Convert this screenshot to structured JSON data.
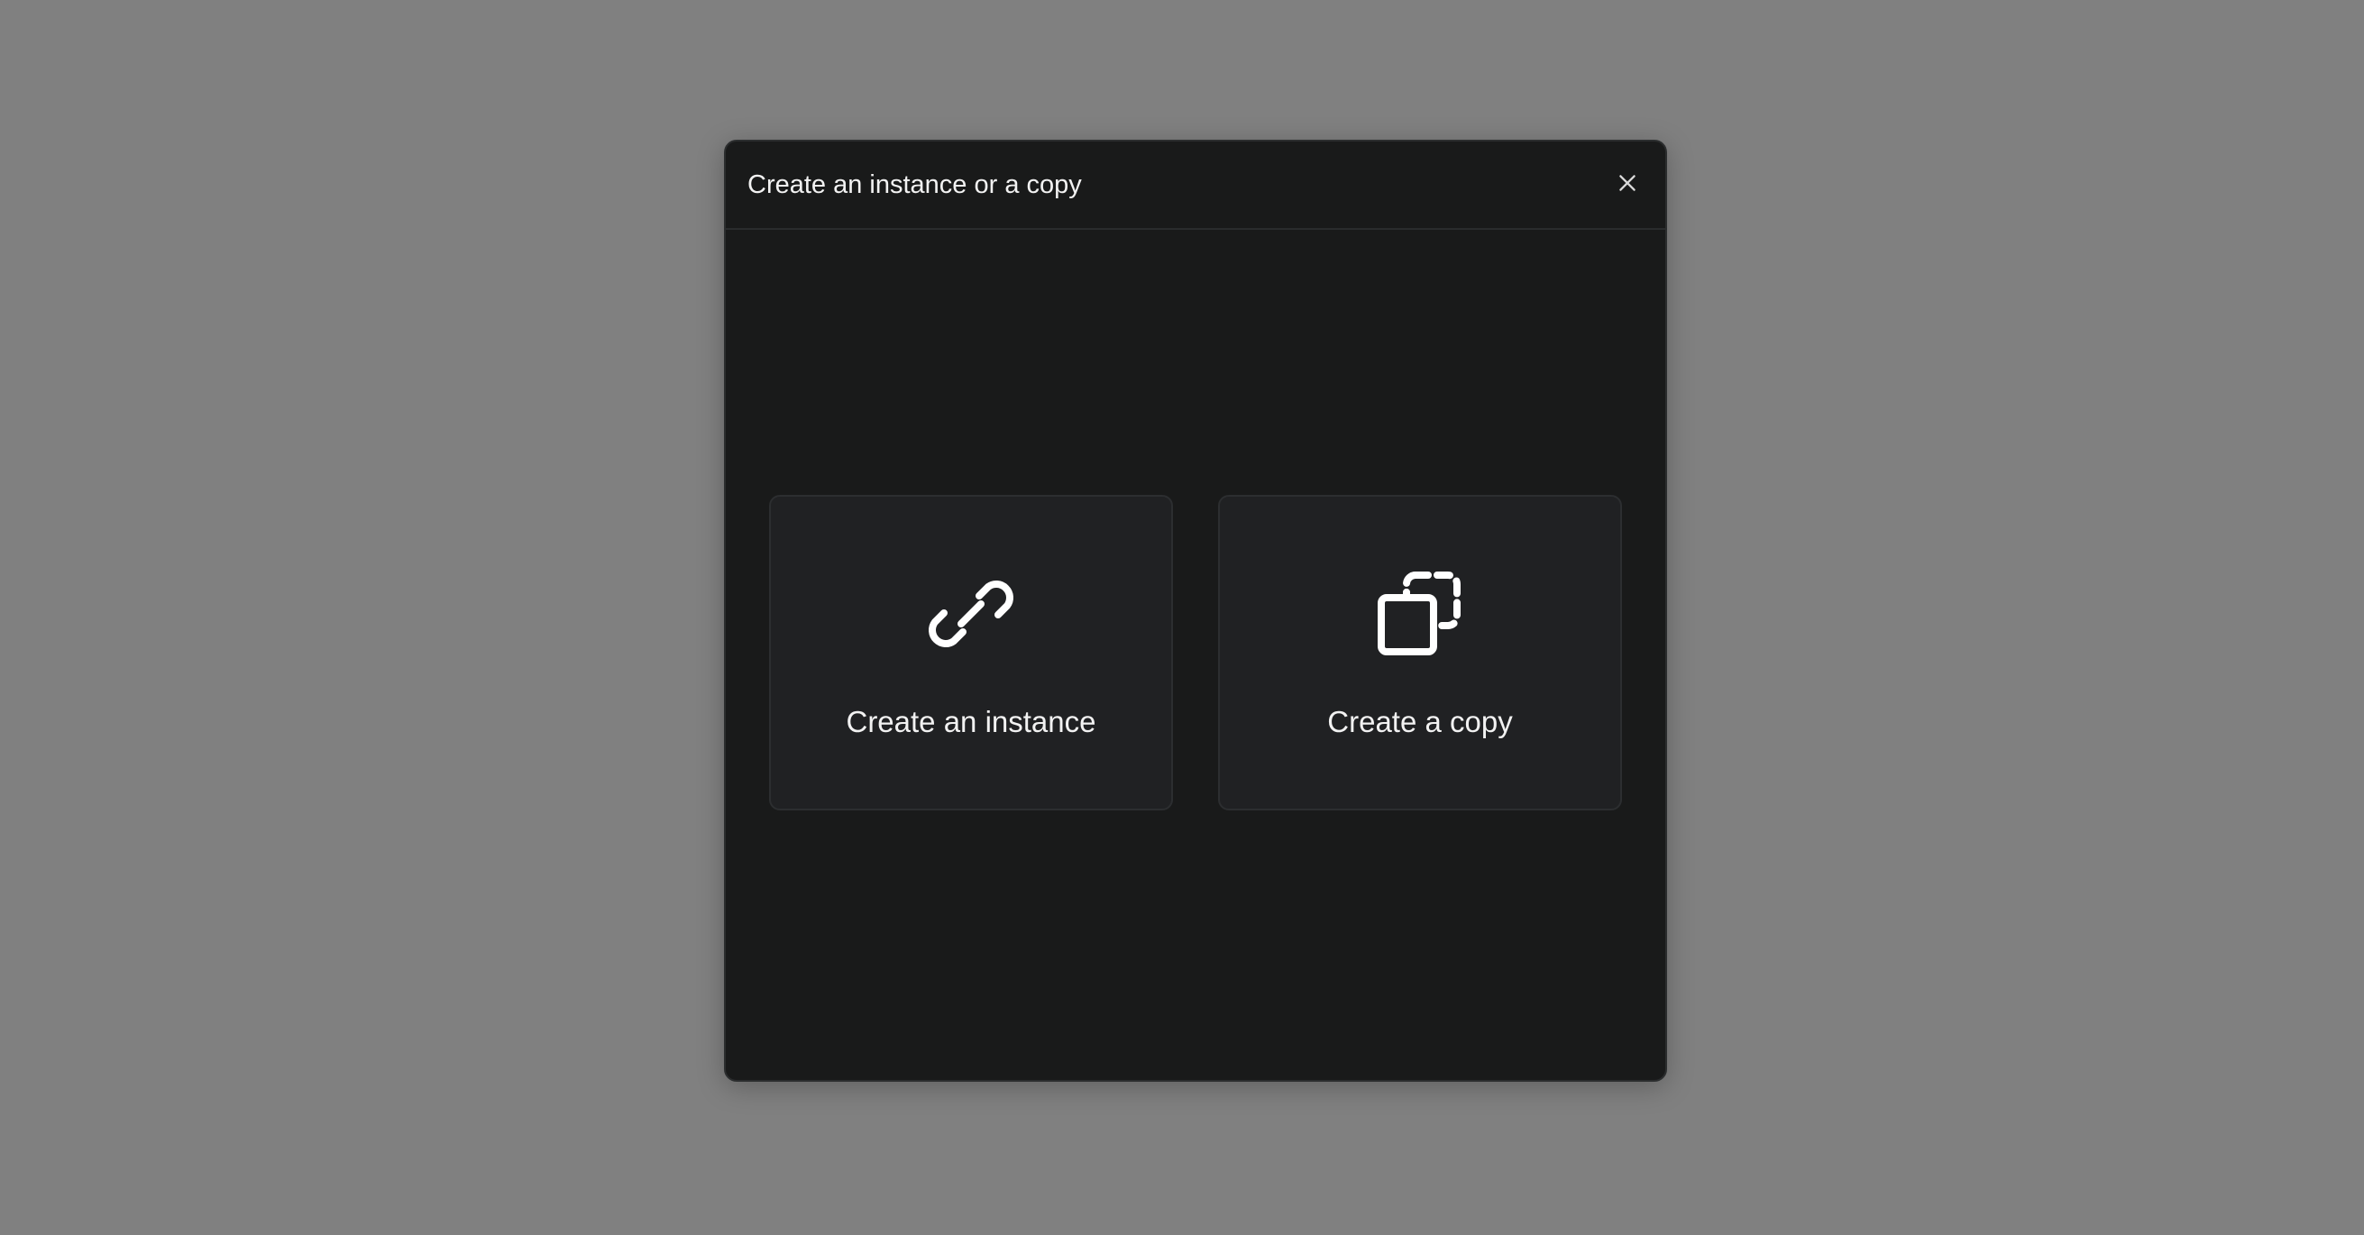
{
  "modal": {
    "title": "Create an instance or a copy",
    "close_icon": "close-icon"
  },
  "options": [
    {
      "label": "Create an instance",
      "icon": "link-icon"
    },
    {
      "label": "Create a copy",
      "icon": "copy-icon"
    }
  ],
  "colors": {
    "backdrop": "#808080",
    "modal_bg": "#191a1a",
    "card_bg": "#202123",
    "text": "#f2f2f2"
  }
}
